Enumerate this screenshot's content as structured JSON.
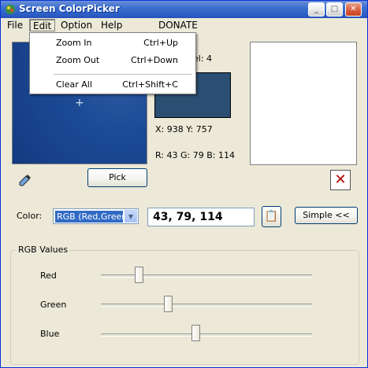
{
  "window": {
    "title": "Screen ColorPicker"
  },
  "menubar": {
    "file": "File",
    "edit": "Edit",
    "option": "Option",
    "help": "Help",
    "donate": "DONATE"
  },
  "edit_menu": {
    "items": [
      {
        "label": "Zoom In",
        "shortcut": "Ctrl+Up"
      },
      {
        "label": "Zoom Out",
        "shortcut": "Ctrl+Down"
      },
      {
        "label": "Clear All",
        "shortcut": "Ctrl+Shift+C"
      }
    ]
  },
  "preview": {
    "level_text": "el: 4",
    "xy_text": "X: 938 Y: 757",
    "rgb_text": "R: 43 G: 79 B: 114",
    "swatch_color": "#2b4f72",
    "canvas_color": "#1c4a95"
  },
  "buttons": {
    "pick": "Pick",
    "simple": "Simple <<"
  },
  "color_row": {
    "label": "Color:",
    "format": "RGB (Red,Green,",
    "value": "43, 79, 114"
  },
  "rgb_group": {
    "title": "RGB Values",
    "sliders": [
      {
        "label": "Red",
        "value": 43
      },
      {
        "label": "Green",
        "value": 79
      },
      {
        "label": "Blue",
        "value": 114
      }
    ]
  }
}
